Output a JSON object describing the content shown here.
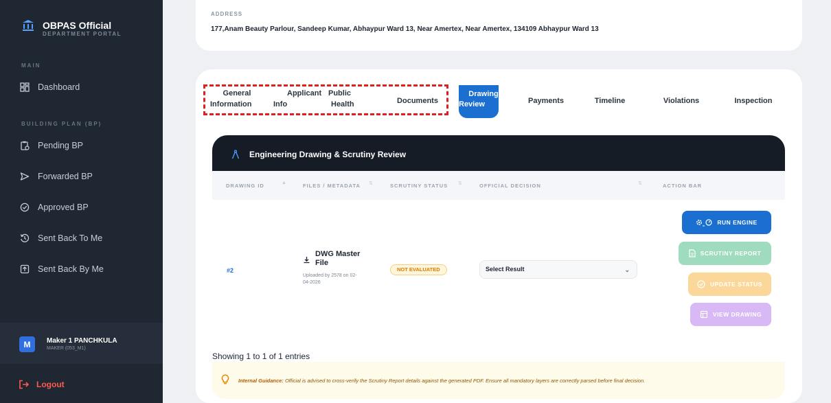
{
  "sidebar": {
    "brand_title": "OBPAS Official",
    "brand_sub": "DEPARTMENT PORTAL",
    "section_main": "MAIN",
    "section_bp": "BUILDING PLAN (BP)",
    "items": [
      {
        "label": "Dashboard",
        "icon": "dashboard-icon"
      },
      {
        "label": "Pending BP",
        "icon": "clipboard-clock-icon"
      },
      {
        "label": "Forwarded BP",
        "icon": "send-icon"
      },
      {
        "label": "Approved BP",
        "icon": "check-circle-icon"
      },
      {
        "label": "Sent Back To Me",
        "icon": "history-icon"
      },
      {
        "label": "Sent Back By Me",
        "icon": "box-arrow-icon"
      }
    ],
    "user": {
      "initial": "M",
      "name": "Maker 1 PANCHKULA",
      "role": "MAKER (053_M1)"
    },
    "logout_label": "Logout"
  },
  "address": {
    "label": "ADDRESS",
    "value": "177,Anam Beauty Parlour, Sandeep Kumar, Abhaypur Ward 13, Near Amertex, Near Amertex, 134109 Abhaypur Ward 13"
  },
  "tabs": {
    "general_l1": "General",
    "general_l2": "Information",
    "applicant_l1": "Applicant",
    "applicant_l2": "Info",
    "public_l1": "Public",
    "public_l2": "Health",
    "documents": "Documents",
    "drawing_l1": "Drawing",
    "drawing_l2": "Review",
    "payments": "Payments",
    "timeline": "Timeline",
    "violations": "Violations",
    "inspection": "Inspection"
  },
  "panel": {
    "title": "Engineering Drawing & Scrutiny Review",
    "columns": [
      "DRAWING ID",
      "FILES / METADATA",
      "SCRUTINY STATUS",
      "OFFICIAL DECISION",
      "ACTION BAR"
    ],
    "row": {
      "id": "#2",
      "file_name": "DWG Master File",
      "file_meta": "Uploaded by 2578 on 02-04-2026",
      "status": "NOT EVALUATED",
      "decision_placeholder": "Select Result"
    },
    "actions": {
      "run_engine": "RUN ENGINE",
      "scrutiny_report": "SCRUTINY REPORT",
      "update_status": "UPDATE STATUS",
      "view_drawing": "VIEW DRAWING"
    },
    "showing": "Showing 1 to 1 of 1 entries",
    "guidance_label": "Internal Guidance:",
    "guidance_text": "Official is advised to cross-verify the Scrutiny Report details against the generated PDF. Ensure all mandatory layers are correctly parsed before final decision."
  },
  "colors": {
    "sidebar_bg": "#1f2732",
    "accent": "#1b6fd1",
    "logout": "#ff5a4f",
    "btn_run": "#1b6fd1",
    "btn_report": "#9fdcbd",
    "btn_update": "#fbd79a",
    "btn_view": "#d8b8f5",
    "highlight": "#e0201e"
  }
}
